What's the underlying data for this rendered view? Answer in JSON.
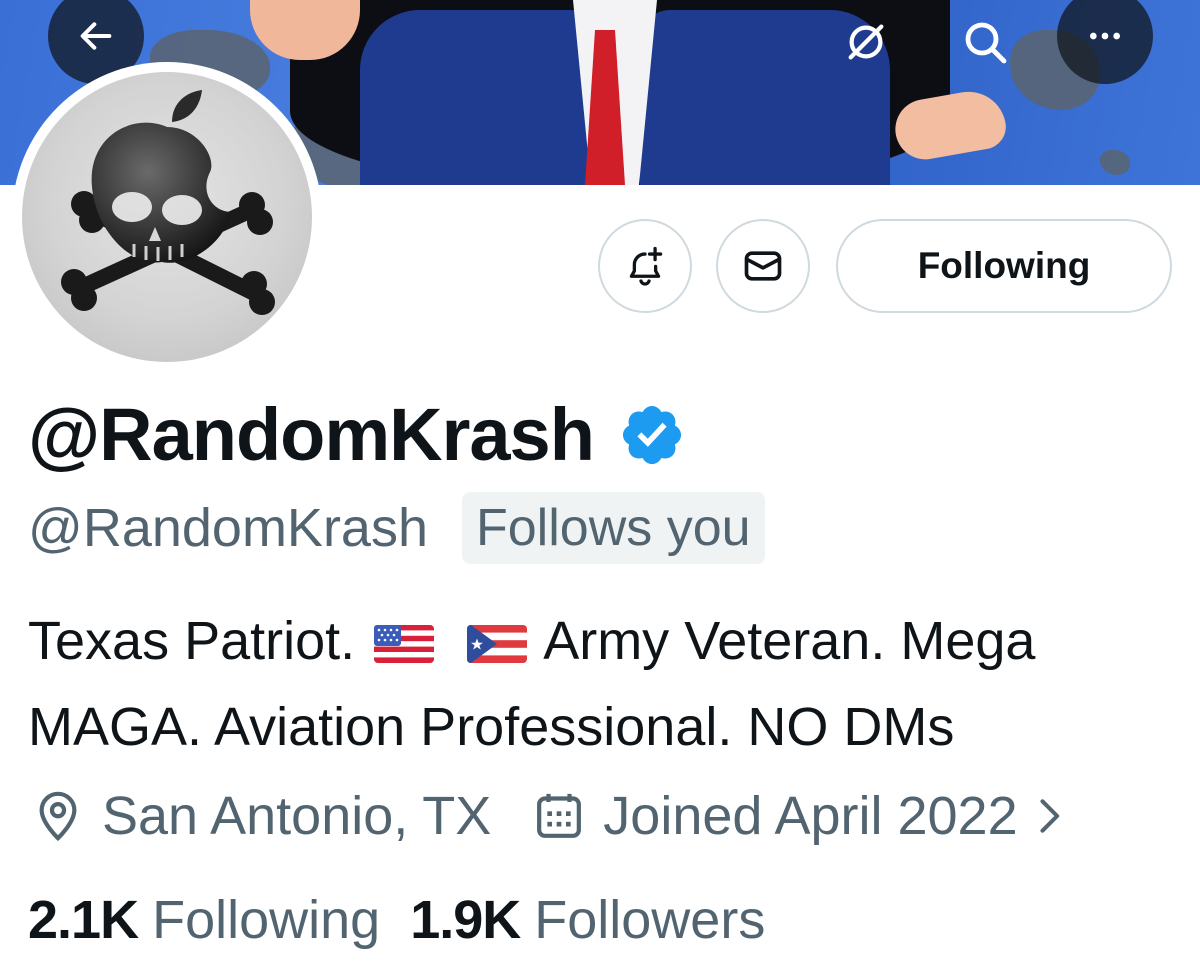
{
  "header": {
    "back_icon": "arrow-left-icon",
    "grok_icon": "slashed-circle-icon",
    "search_icon": "search-icon",
    "more_icon": "more-horizontal-icon"
  },
  "actions": {
    "notify_icon": "bell-plus-icon",
    "message_icon": "envelope-icon",
    "following_label": "Following"
  },
  "profile": {
    "display_name": "@RandomKrash",
    "verified_icon": "verified-badge-icon",
    "verified_color": "#1d9bf0",
    "handle": "@RandomKrash",
    "follows_you": "Follows you",
    "bio_part1": "Texas Patriot.",
    "bio_part2": "Army Veteran. Mega MAGA. Aviation Professional. NO DMs",
    "bio_flags": [
      "us-flag-emoji",
      "puerto-rico-flag-emoji"
    ],
    "location": "San Antonio, TX",
    "joined": "Joined April 2022"
  },
  "stats": {
    "following_count": "2.1K",
    "following_label": "Following",
    "followers_count": "1.9K",
    "followers_label": "Followers"
  },
  "colors": {
    "text_primary": "#0f1419",
    "text_secondary": "#536471",
    "border": "#cfd9de"
  }
}
